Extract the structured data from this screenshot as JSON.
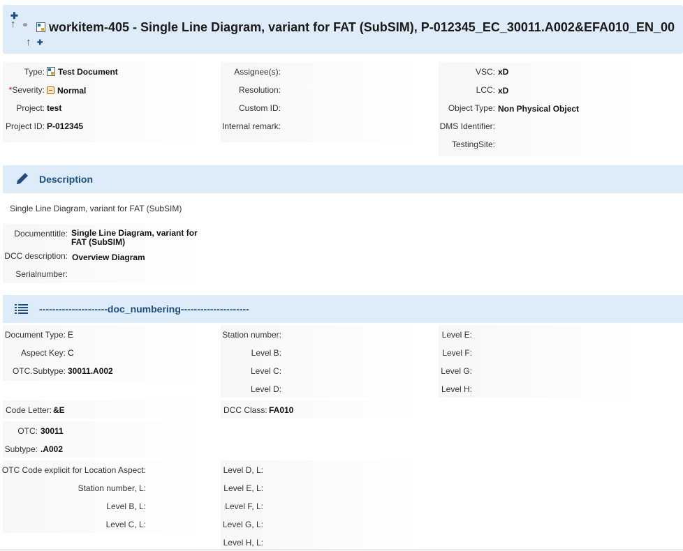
{
  "header": {
    "title": "workitem-405 - Single Line Diagram, variant for FAT (SubSIM), P-012345_EC_30011.A002&EFA010_EN_00"
  },
  "fields": {
    "col1": [
      {
        "label": "Type:",
        "value": "Test Document",
        "icon": "document-type-icon"
      },
      {
        "label": "Severity:",
        "required": "*",
        "value": "Normal",
        "icon": "severity-normal-icon"
      },
      {
        "label": "Project:",
        "value": "test"
      },
      {
        "label": "Project ID:",
        "value": "P-012345"
      }
    ],
    "col2": [
      {
        "label": "Assignee(s):",
        "value": ""
      },
      {
        "label": "Resolution:",
        "value": ""
      },
      {
        "label": "Custom ID:",
        "value": ""
      },
      {
        "label": "Internal remark:",
        "value": ""
      }
    ],
    "col3": [
      {
        "label": "VSC:",
        "value": "xD"
      },
      {
        "label": "LCC:",
        "value": "xD"
      },
      {
        "label": "Object Type:",
        "value": "Non Physical Object"
      },
      {
        "label": "DMS Identifier:",
        "value": ""
      },
      {
        "label": "TestingSite:",
        "value": ""
      }
    ]
  },
  "description": {
    "section_title": "Description",
    "text": "Single Line Diagram, variant for FAT (SubSIM)",
    "fields": [
      {
        "label": "Documenttitle:",
        "value_line1": "Single Line Diagram, variant for",
        "value_line2": "FAT (SubSIM)"
      },
      {
        "label": "DCC description:",
        "value": "Overview Diagram"
      },
      {
        "label": "Serialnumber:",
        "value": ""
      }
    ]
  },
  "doc_numbering": {
    "section_title": "---------------------doc_numbering---------------------",
    "col1": [
      {
        "label": "Document Type:",
        "value": "E"
      },
      {
        "label": "Aspect Key:",
        "value": "C"
      },
      {
        "label": "OTC.Subtype:",
        "value": "30011.A002"
      }
    ],
    "col2": [
      {
        "label": "Station number:",
        "value": ""
      },
      {
        "label": "Level B:",
        "value": ""
      },
      {
        "label": "Level C:",
        "value": ""
      },
      {
        "label": "Level D:",
        "value": ""
      }
    ],
    "col3": [
      {
        "label": "Level E:",
        "value": ""
      },
      {
        "label": "Level F:",
        "value": ""
      },
      {
        "label": "Level G:",
        "value": ""
      },
      {
        "label": "Level H:",
        "value": ""
      }
    ],
    "code_letter": {
      "label": "Code Letter:",
      "value": "&E"
    },
    "dcc_class": {
      "label": "DCC Class:",
      "value": "FA010"
    },
    "otc": {
      "label": "OTC:",
      "value": "30011"
    },
    "subtype": {
      "label": "Subtype:",
      "value": ".A002"
    },
    "location_left": [
      {
        "label": "OTC Code explicit for Location Aspect:",
        "value": ""
      },
      {
        "label": "Station number, L:",
        "value": ""
      },
      {
        "label": "Level B, L:",
        "value": ""
      },
      {
        "label": "Level C, L:",
        "value": ""
      }
    ],
    "location_right": [
      {
        "label": "Level D, L:",
        "value": ""
      },
      {
        "label": "Level E, L:",
        "value": ""
      },
      {
        "label": "Level F, L:",
        "value": ""
      },
      {
        "label": "Level G, L:",
        "value": ""
      },
      {
        "label": "Level H, L:",
        "value": ""
      }
    ]
  },
  "colors": {
    "header_bg": "#ddecf8",
    "accent": "#1c4e80"
  }
}
